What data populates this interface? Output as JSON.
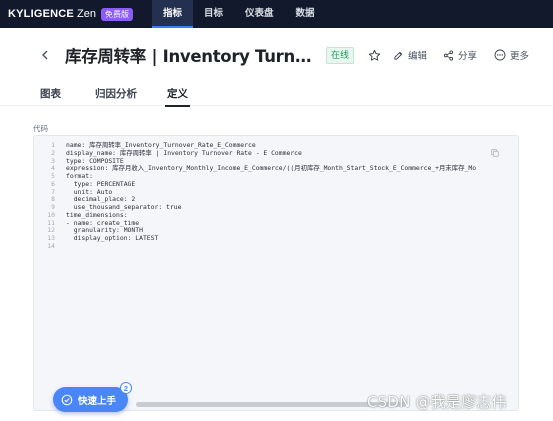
{
  "topnav": {
    "logo_main": "KYLIGENCE",
    "logo_sub": "Zen",
    "badge": "免费版",
    "items": [
      {
        "label": "指标",
        "active": true
      },
      {
        "label": "目标",
        "active": false
      },
      {
        "label": "仪表盘",
        "active": false
      },
      {
        "label": "数据",
        "active": false
      }
    ]
  },
  "header": {
    "title": "库存周转率 | Inventory Turnover Rate",
    "status": "在线",
    "actions": {
      "edit": "编辑",
      "share": "分享",
      "more": "更多"
    }
  },
  "tabs": [
    {
      "label": "图表",
      "active": false
    },
    {
      "label": "归因分析",
      "active": false
    },
    {
      "label": "定义",
      "active": true
    }
  ],
  "code_label": "代码",
  "code": [
    {
      "n": "1",
      "text": "name: 库存周转率_Inventory_Turnover_Rate_E_Commerce"
    },
    {
      "n": "2",
      "text": "display_name: 库存周转率 | Inventory Turnover Rate - E Commerce"
    },
    {
      "n": "3",
      "text": "type: COMPOSITE"
    },
    {
      "n": "4",
      "text": "expression: 库存月收入_Inventory_Monthly_Income_E_Commerce/((月初库存_Month_Start_Stock_E_Commerce_+月末库存_Mo"
    },
    {
      "n": "5",
      "text": "format:"
    },
    {
      "n": "6",
      "text": "  type: PERCENTAGE"
    },
    {
      "n": "7",
      "text": "  unit: Auto"
    },
    {
      "n": "8",
      "text": "  decimal_place: 2"
    },
    {
      "n": "9",
      "text": "  use_thousand_separator: true"
    },
    {
      "n": "10",
      "text": "time_dimensions:"
    },
    {
      "n": "11",
      "text": "- name: create_time"
    },
    {
      "n": "12",
      "text": "  granularity: MONTH"
    },
    {
      "n": "13",
      "text": "  display_option: LATEST"
    },
    {
      "n": "14",
      "text": ""
    }
  ],
  "quickstart": {
    "label": "快速上手",
    "count": "2"
  },
  "watermark": "CSDN @我是廖志伟",
  "colors": {
    "nav_bg": "#12192c",
    "accent": "#3a7bff",
    "online_green": "#1a9b5b",
    "quickstart": "#4a86f7"
  }
}
